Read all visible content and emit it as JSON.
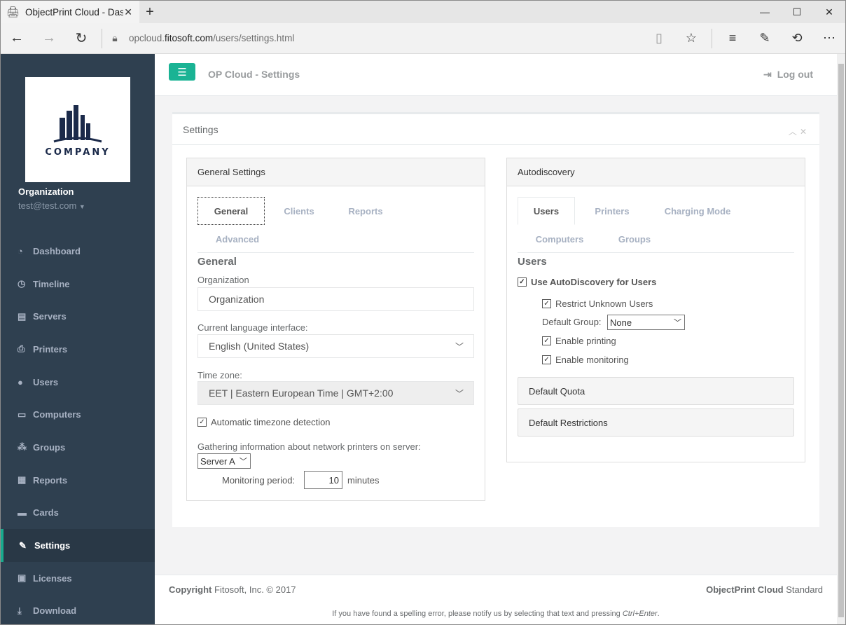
{
  "browser": {
    "tab_title": "ObjectPrint Cloud - Das",
    "tab_close": "✕",
    "new_tab": "+",
    "url_prefix": "opcloud.",
    "url_domain": "fitosoft.com",
    "url_path": "/users/settings.html"
  },
  "sidebar": {
    "logo_text": "COMPANY",
    "org_name": "Organization",
    "org_email": "test@test.com",
    "items": [
      {
        "label": "Dashboard",
        "icon": "tachometer-icon"
      },
      {
        "label": "Timeline",
        "icon": "clock-icon"
      },
      {
        "label": "Servers",
        "icon": "server-icon"
      },
      {
        "label": "Printers",
        "icon": "printer-icon"
      },
      {
        "label": "Users",
        "icon": "user-icon"
      },
      {
        "label": "Computers",
        "icon": "laptop-icon"
      },
      {
        "label": "Groups",
        "icon": "users-icon"
      },
      {
        "label": "Reports",
        "icon": "chart-icon"
      },
      {
        "label": "Cards",
        "icon": "credit-card-icon"
      },
      {
        "label": "Settings",
        "icon": "wrench-icon",
        "active": true
      },
      {
        "label": "Licenses",
        "icon": "license-icon"
      },
      {
        "label": "Download",
        "icon": "download-icon"
      }
    ]
  },
  "header": {
    "title": "OP Cloud - Settings",
    "logout": "Log out"
  },
  "settings": {
    "title": "Settings",
    "general": {
      "panel_title": "General Settings",
      "tabs": [
        "General",
        "Clients",
        "Reports",
        "Advanced"
      ],
      "section": "General",
      "org_label": "Organization",
      "org_value": "Organization",
      "lang_label": "Current language interface:",
      "lang_value": "English (United States)",
      "tz_label": "Time zone:",
      "tz_value": "EET | Eastern European Time | GMT+2:00",
      "auto_tz": "Automatic timezone detection",
      "gather_label": "Gathering information about network printers on server:",
      "server_value": "Server A",
      "monitor_label": "Monitoring period:",
      "monitor_value": "10",
      "monitor_unit": "minutes"
    },
    "autodiscovery": {
      "panel_title": "Autodiscovery",
      "tabs": [
        "Users",
        "Printers",
        "Charging Mode",
        "Computers",
        "Groups"
      ],
      "section": "Users",
      "use_ad": "Use AutoDiscovery for Users",
      "restrict": "Restrict Unknown Users",
      "default_group_label": "Default Group:",
      "default_group_value": "None",
      "enable_printing": "Enable printing",
      "enable_monitoring": "Enable monitoring",
      "default_quota": "Default Quota",
      "default_restrictions": "Default Restrictions"
    }
  },
  "footer": {
    "copyright_bold": "Copyright",
    "copyright_rest": " Fitosoft, Inc. © 2017",
    "product_bold": "ObjectPrint Cloud",
    "product_rest": " Standard",
    "spell_text": "If you have found a spelling error, please notify us by selecting that text and pressing ",
    "spell_key": "Ctrl+Enter",
    "spell_end": "."
  },
  "colors": {
    "sidebar": "#2f4050",
    "accent": "#1ab394",
    "active_nav": "#293846"
  }
}
